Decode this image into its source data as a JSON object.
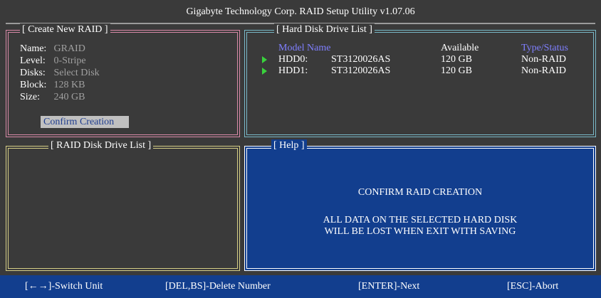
{
  "title": "Gigabyte Technology Corp.  RAID Setup Utility  v1.07.06",
  "create_panel": {
    "title": "[ Create New RAID ]",
    "fields": [
      {
        "label": "Name:",
        "value": "GRAID"
      },
      {
        "label": "Level:",
        "value": "0-Stripe"
      },
      {
        "label": "Disks:",
        "value": "Select Disk"
      },
      {
        "label": "Block:",
        "value": "128 KB"
      },
      {
        "label": "Size:",
        "value": "240 GB"
      }
    ],
    "confirm_label": "Confirm Creation"
  },
  "hdd_panel": {
    "title": "[ Hard Disk Drive List ]",
    "headers": {
      "model": "Model Name",
      "available": "Available",
      "type": "Type/Status"
    },
    "rows": [
      {
        "id": "HDD0:",
        "model": "ST3120026AS",
        "available": "120 GB",
        "type": "Non-RAID"
      },
      {
        "id": "HDD1:",
        "model": "ST3120026AS",
        "available": "120 GB",
        "type": "Non-RAID"
      }
    ]
  },
  "raid_list_panel": {
    "title": "[ RAID Disk Drive List ]"
  },
  "help_panel": {
    "title": "[ Help ]",
    "heading": "CONFIRM RAID CREATION",
    "line1": "ALL DATA ON THE SELECTED HARD DISK",
    "line2": "WILL BE LOST WHEN EXIT WITH SAVING"
  },
  "footer": {
    "switch": "[←→]-Switch Unit",
    "delete": "[DEL,BS]-Delete Number",
    "next": "[ENTER]-Next",
    "abort": "[ESC]-Abort"
  },
  "colors": {
    "background": "#3a3a3a",
    "create_border": "#d98aa8",
    "hdd_border": "#79b9c8",
    "raidlist_border": "#d7cf86",
    "help_bg": "#123e8e",
    "header_text": "#7f7fff",
    "arrow": "#39d23c"
  }
}
